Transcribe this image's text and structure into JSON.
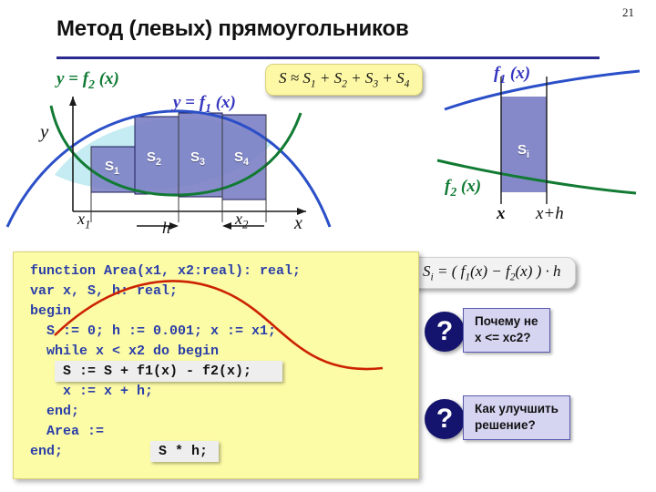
{
  "slide": {
    "page_number": "21",
    "title": "Метод (левых) прямоугольников"
  },
  "formulas": {
    "sum_box": "S ≈ S1 + S2 + S3 + S4",
    "sum_parts": {
      "lead": "S ≈ S",
      "s1": "1",
      "plus": " + S",
      "s2": "2",
      "s3": "3",
      "s4": "4"
    },
    "si_box": "Si = ( f1(x) − f2(x) ) · h"
  },
  "diagram_left": {
    "label_f2": "y = f2 (x)",
    "label_f1": "y = f1 (x)",
    "axis_y": "y",
    "axis_x": "x",
    "tick_x1": "x1",
    "tick_x2": "x2",
    "step_h": "h",
    "rect_labels": [
      "S1",
      "S2",
      "S3",
      "S4"
    ],
    "curve_color_f1": "#3434c0",
    "curve_color_f2": "#0f7a32",
    "rect_fill": "#7b7fc4",
    "lens_fill": "#c5ecf2"
  },
  "diagram_right": {
    "label_f1": "f1 (x)",
    "label_f2": "f2 (x)",
    "tick_x": "x",
    "tick_xh": "x+h",
    "rect_label": "Si",
    "rect_fill": "#7b7fc4"
  },
  "code": {
    "language": "pascal",
    "text": "function Area(x1, x2:real): real;\nvar x, S, h: real;\nbegin\n  S := 0; h := 0.001; x := x1;\n  while x < x2 do begin\n\n    x := x + h;\n  end;\n  Area := \nend;",
    "lines": [
      "function Area(x1, x2:real): real;",
      "var x, S, h: real;",
      "begin",
      "  S := 0; h := 0.001; x := x1;",
      "  while x < x2 do begin",
      "    S := S + f1(x) - f2(x);",
      "    x := x + h;",
      "  end;",
      "  Area := S * h;",
      "end;"
    ],
    "overlay_sum": "S := S + f1(x) - f2(x);",
    "overlay_area": "S * h;",
    "code_color": "#2b3fa8",
    "overlay_color": "#111111"
  },
  "callouts": [
    {
      "icon": "?",
      "line1": "Почему не",
      "line2": "x <= xс2?"
    },
    {
      "icon": "?",
      "line1": "Как улучшить",
      "line2": "решение?"
    }
  ],
  "colors": {
    "rule": "#2b2b8f",
    "code_bg": "#fcfba6",
    "callout_bg": "#d5d5f2",
    "callout_circle": "#14146e",
    "pointer": "#cc2200"
  }
}
